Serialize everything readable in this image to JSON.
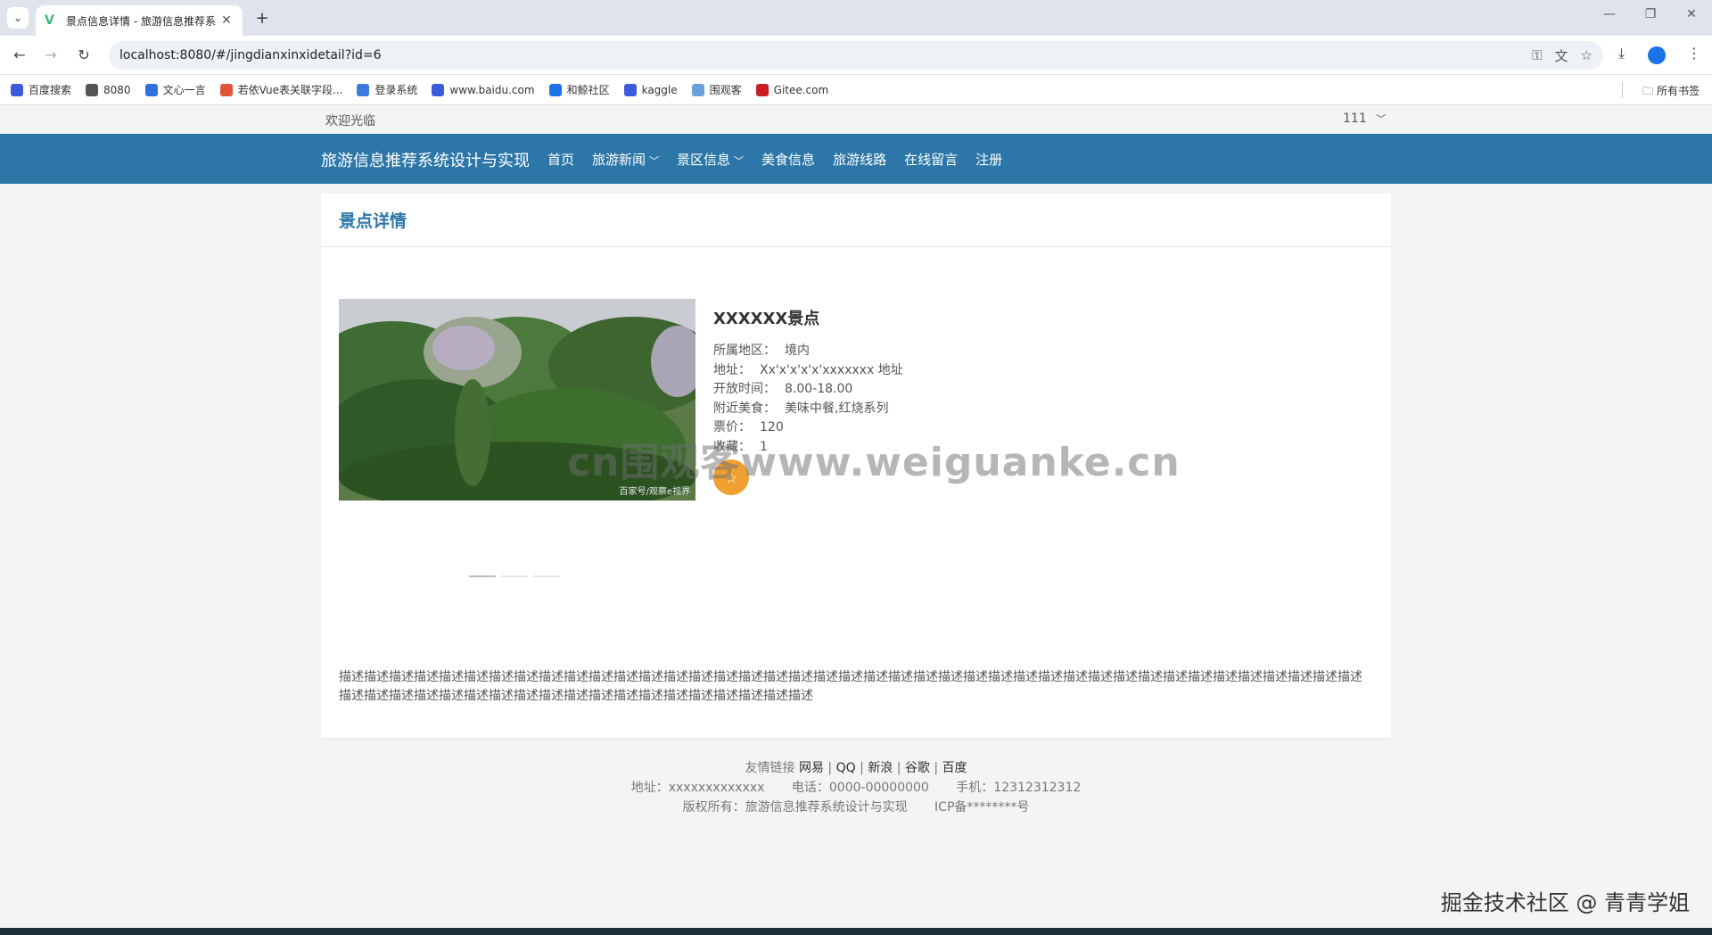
{
  "browser": {
    "tab_title": "景点信息详情 - 旅游信息推荐系",
    "url": "localhost:8080/#/jingdianxinxidetail?id=6",
    "bookmarks": [
      {
        "label": "百度搜索",
        "color": "#3b5bdb"
      },
      {
        "label": "8080",
        "color": "#555555"
      },
      {
        "label": "文心一言",
        "color": "#2f6fe0"
      },
      {
        "label": "若依Vue表关联字段...",
        "color": "#e0553b"
      },
      {
        "label": "登录系统",
        "color": "#3b7be0"
      },
      {
        "label": "www.baidu.com",
        "color": "#3b5bdb"
      },
      {
        "label": "和鲸社区",
        "color": "#1a73e8"
      },
      {
        "label": "kaggle",
        "color": "#3b5bdb"
      },
      {
        "label": "围观客",
        "color": "#6aa0e0"
      },
      {
        "label": "Gitee.com",
        "color": "#c71d23"
      }
    ],
    "all_bookmarks": "所有书签"
  },
  "site": {
    "welcome": "欢迎光临",
    "user": "111",
    "brand": "旅游信息推荐系统设计与实现",
    "nav": [
      {
        "label": "首页",
        "dropdown": false
      },
      {
        "label": "旅游新闻",
        "dropdown": true
      },
      {
        "label": "景区信息",
        "dropdown": true
      },
      {
        "label": "美食信息",
        "dropdown": false
      },
      {
        "label": "旅游线路",
        "dropdown": false
      },
      {
        "label": "在线留言",
        "dropdown": false
      },
      {
        "label": "注册",
        "dropdown": false
      }
    ],
    "accent": "#2d77a8"
  },
  "detail": {
    "heading": "景点详情",
    "photo_watermark": "百家号/观察e视界",
    "name": "XXXXXX景点",
    "fields": [
      {
        "k": "所属地区：",
        "v": "境内"
      },
      {
        "k": "地址：",
        "v": "Xx'x'x'x'x'xxxxxxx 地址"
      },
      {
        "k": "开放时间：",
        "v": "8.00-18.00"
      },
      {
        "k": "附近美食：",
        "v": "美味中餐,红烧系列"
      },
      {
        "k": "票价：",
        "v": "120"
      },
      {
        "k": "收藏：",
        "v": "1"
      }
    ],
    "favorite_icon": "star-icon",
    "description": "描述描述描述描述描述描述描述描述描述描述描述描述描述描述描述描述描述描述描述描述描述描述描述描述描述描述描述描述描述描述描述描述描述描述描述描述描述描述描述描述描述描述描述描述描述描述描述描述描述描述描述描述描述描述描述描述描述描述描述描述"
  },
  "footer": {
    "links_label": "友情链接",
    "links": [
      "网易",
      "QQ",
      "新浪",
      "谷歌",
      "百度"
    ],
    "address": "地址：xxxxxxxxxxxxx",
    "phone": "电话：0000-00000000",
    "mobile": "手机：12312312312",
    "copyright": "版权所有：旅游信息推荐系统设计与实现",
    "icp": "ICP备********号"
  },
  "overlay": {
    "watermark": "cn围观客www.weiguanke.cn",
    "juejin": "掘金技术社区 @ 青青学姐"
  }
}
